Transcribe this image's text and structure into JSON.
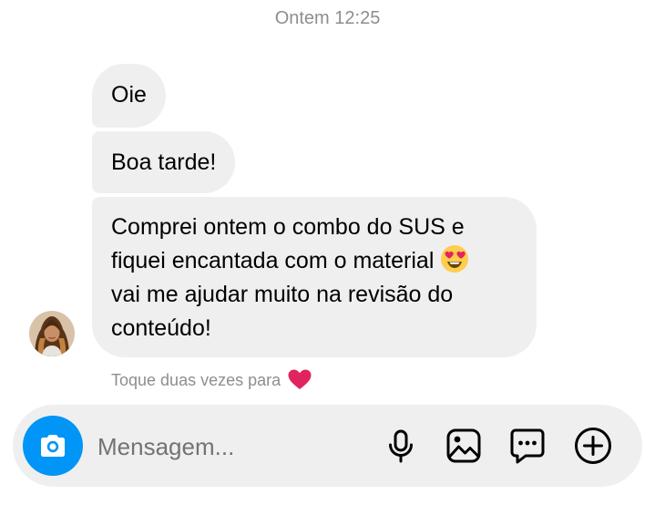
{
  "chat": {
    "timestamp": "Ontem 12:25",
    "messages": [
      {
        "lines": [
          "Oie"
        ]
      },
      {
        "lines": [
          "Boa tarde!"
        ]
      },
      {
        "lines": [
          "Comprei ontem o combo do SUS e",
          "fiquei encantada com o material",
          "vai me ajudar muito na revisão do",
          "conteúdo!"
        ],
        "emoji": "heart-eyes-emoji"
      }
    ],
    "hint_text": "Toque duas vezes para",
    "hint_icon": "red-heart-icon"
  },
  "composer": {
    "placeholder": "Mensagem...",
    "icons": [
      "camera-icon",
      "microphone-icon",
      "gallery-icon",
      "sticker-message-icon",
      "add-icon"
    ],
    "accent_color": "#0095f6"
  },
  "colors": {
    "bubble_bg": "#efefef",
    "meta_text": "#8e8e8e"
  }
}
